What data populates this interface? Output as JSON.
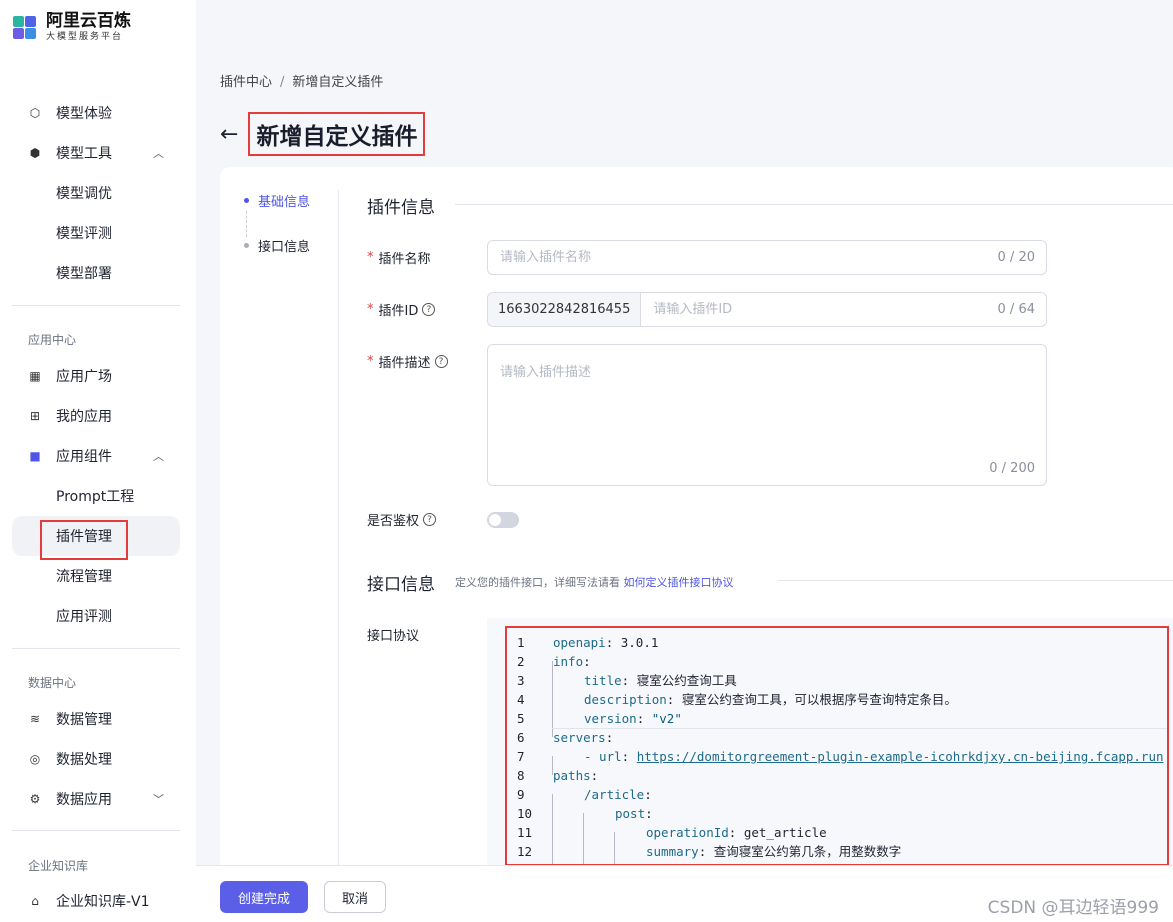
{
  "brand": {
    "title": "阿里云百炼",
    "subtitle": "大模型服务平台"
  },
  "sidebar": {
    "items": [
      {
        "label": "模型体验",
        "icon": "cube-icon"
      },
      {
        "label": "模型工具",
        "icon": "tool-icon"
      },
      {
        "label": "模型调优"
      },
      {
        "label": "模型评测"
      },
      {
        "label": "模型部署"
      },
      {
        "label": "应用广场",
        "icon": "grid-icon"
      },
      {
        "label": "我的应用",
        "icon": "apps-icon"
      },
      {
        "label": "应用组件",
        "icon": "folder-icon"
      },
      {
        "label": "Prompt工程"
      },
      {
        "label": "插件管理"
      },
      {
        "label": "流程管理"
      },
      {
        "label": "应用评测"
      },
      {
        "label": "数据管理",
        "icon": "database-icon"
      },
      {
        "label": "数据处理",
        "icon": "process-icon"
      },
      {
        "label": "数据应用",
        "icon": "gear-icon"
      },
      {
        "label": "企业知识库-V1",
        "icon": "book-icon"
      }
    ],
    "sections": {
      "app_center": "应用中心",
      "data_center": "数据中心",
      "knowledge": "企业知识库"
    }
  },
  "breadcrumb": {
    "parent": "插件中心",
    "sep": "/",
    "current": "新增自定义插件"
  },
  "page": {
    "title": "新增自定义插件"
  },
  "steps": [
    "基础信息",
    "接口信息"
  ],
  "form": {
    "section_info": "插件信息",
    "name_label": "插件名称",
    "name_placeholder": "请输入插件名称",
    "name_counter": "0 / 20",
    "id_label": "插件ID",
    "id_prefix": "1663022842816455",
    "id_placeholder": "请输入插件ID",
    "id_counter": "0 / 64",
    "desc_label": "插件描述",
    "desc_placeholder": "请输入插件描述",
    "desc_counter": "0 / 200",
    "auth_label": "是否鉴权",
    "section_api": "接口信息",
    "api_hint": "定义您的插件接口，详细写法请看",
    "api_hint_link": "如何定义插件接口协议",
    "protocol_label": "接口协议"
  },
  "code_lines": [
    {
      "n": "1",
      "key": "openapi",
      "val": " 3.0.1"
    },
    {
      "n": "2",
      "key": "info",
      "val": ""
    },
    {
      "n": "3",
      "key": "title",
      "val": " 寝室公约查询工具"
    },
    {
      "n": "4",
      "key": "description",
      "val": " 寝室公约查询工具，可以根据序号查询特定条目。"
    },
    {
      "n": "5",
      "key": "version",
      "val": " \"v2\""
    },
    {
      "n": "6",
      "key": "servers",
      "val": ""
    },
    {
      "n": "7",
      "key": "- url",
      "val": "https://domitorgreement-plugin-example-icohrkdjxy.cn-beijing.fcapp.run"
    },
    {
      "n": "8",
      "key": "paths",
      "val": ""
    },
    {
      "n": "9",
      "key": "/article",
      "val": ""
    },
    {
      "n": "10",
      "key": "post",
      "val": ""
    },
    {
      "n": "11",
      "key": "operationId",
      "val": " get_article"
    },
    {
      "n": "12",
      "key": "summary",
      "val": " 查询寝室公约第几条，用整数数字"
    }
  ],
  "footer": {
    "submit": "创建完成",
    "cancel": "取消"
  },
  "watermark": "CSDN @耳边轻语999",
  "colors": {
    "accent": "#5b5fe8",
    "highlight": "#e23c3c"
  }
}
